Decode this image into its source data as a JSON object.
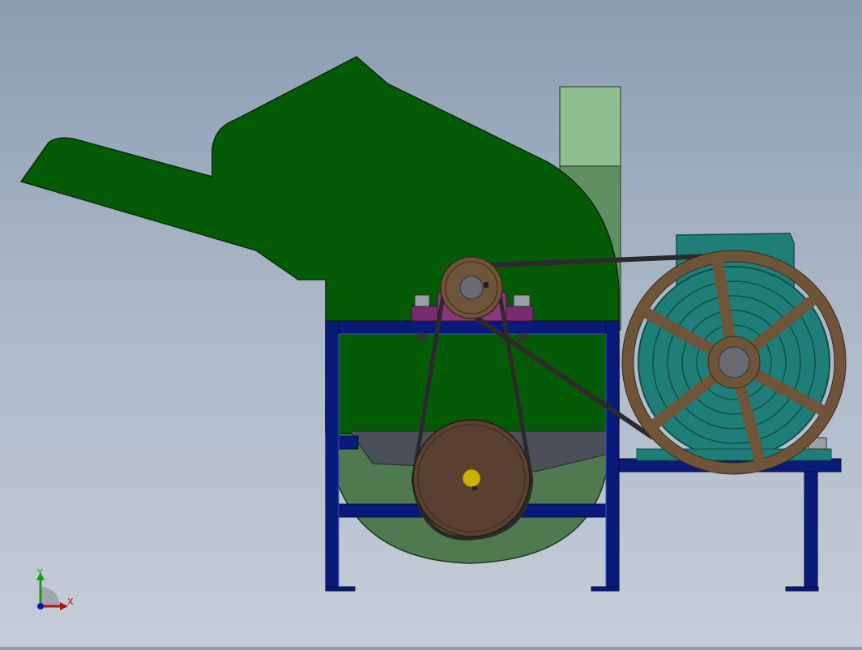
{
  "viewport": {
    "background_top": "#8b9db2",
    "background_bottom": "#c6cdd8"
  },
  "colors": {
    "hopper_green": "#055a05",
    "hopper_outline": "#0a2a0a",
    "housing_light_green": "#4f7a4f",
    "chute_green": "#5f8f63",
    "chute_top": "#8fbf8f",
    "frame_blue": "#0a1a78",
    "frame_blue_light": "#1e2f95",
    "motor_teal": "#1f7f78",
    "motor_dark": "#0f4f4a",
    "pulley_brown": "#6e5438",
    "pulley_dark": "#3a2a18",
    "bearing_purple": "#7a2a6e",
    "belt_dark": "#2a2a2a",
    "hub_grey": "#6a6a72",
    "shaft_yellow": "#c8b400",
    "discharge_grey": "#4a4f58"
  },
  "triad": {
    "x_label": "X",
    "y_label": "Y",
    "x_color": "#b01010",
    "y_color": "#10a010",
    "z_color": "#1010b0"
  }
}
